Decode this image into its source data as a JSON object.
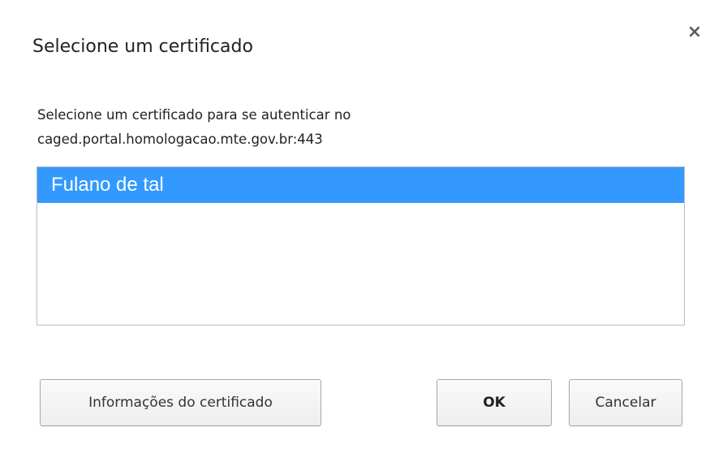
{
  "dialog": {
    "title": "Selecione um certificado",
    "close_label": "×",
    "description_line1": "Selecione um certificado para se autenticar no",
    "description_line2": "caged.portal.homologacao.mte.gov.br:443"
  },
  "certificates": [
    {
      "label": "Fulano de tal",
      "selected": true
    }
  ],
  "buttons": {
    "info_label": "Informações do certificado",
    "ok_label": "OK",
    "cancel_label": "Cancelar"
  },
  "colors": {
    "selection": "#3399ff",
    "selection_text": "#ffffff"
  },
  "icons": {
    "close": "close-icon"
  }
}
